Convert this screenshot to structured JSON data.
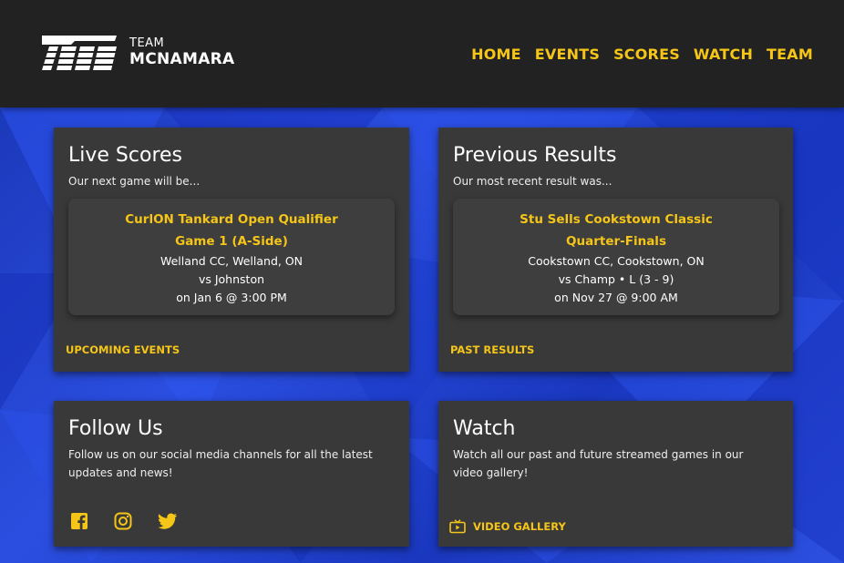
{
  "header": {
    "brand_small": "TEAM",
    "brand_big": "MCNAMARA",
    "nav": [
      {
        "label": "HOME"
      },
      {
        "label": "EVENTS"
      },
      {
        "label": "SCORES"
      },
      {
        "label": "WATCH"
      },
      {
        "label": "TEAM"
      }
    ]
  },
  "live_scores": {
    "title": "Live Scores",
    "subtitle": "Our next game will be...",
    "event_line1": "CurlON Tankard Open Qualifier",
    "event_line2": "Game 1 (A-Side)",
    "location": "Welland CC, Welland, ON",
    "opponent": "vs Johnston",
    "date": "on Jan 6 @ 3:00 PM",
    "link": "UPCOMING EVENTS"
  },
  "previous_results": {
    "title": "Previous Results",
    "subtitle": "Our most recent result was...",
    "event_line1": "Stu Sells Cookstown Classic",
    "event_line2": "Quarter-Finals",
    "location": "Cookstown CC, Cookstown, ON",
    "result": "vs Champ • L (3 - 9)",
    "date": "on Nov 27 @ 9:00 AM",
    "link": "PAST RESULTS"
  },
  "follow_us": {
    "title": "Follow Us",
    "text": "Follow us on our social media channels for all the latest updates and news!",
    "icons": [
      "facebook-icon",
      "instagram-icon",
      "twitter-icon"
    ]
  },
  "watch": {
    "title": "Watch",
    "text": "Watch all our past and future streamed games in our video gallery!",
    "link": "VIDEO GALLERY"
  },
  "colors": {
    "accent": "#f5c518",
    "header_bg": "#222222",
    "card_bg": "#393939",
    "page_bg": "#2045df"
  }
}
